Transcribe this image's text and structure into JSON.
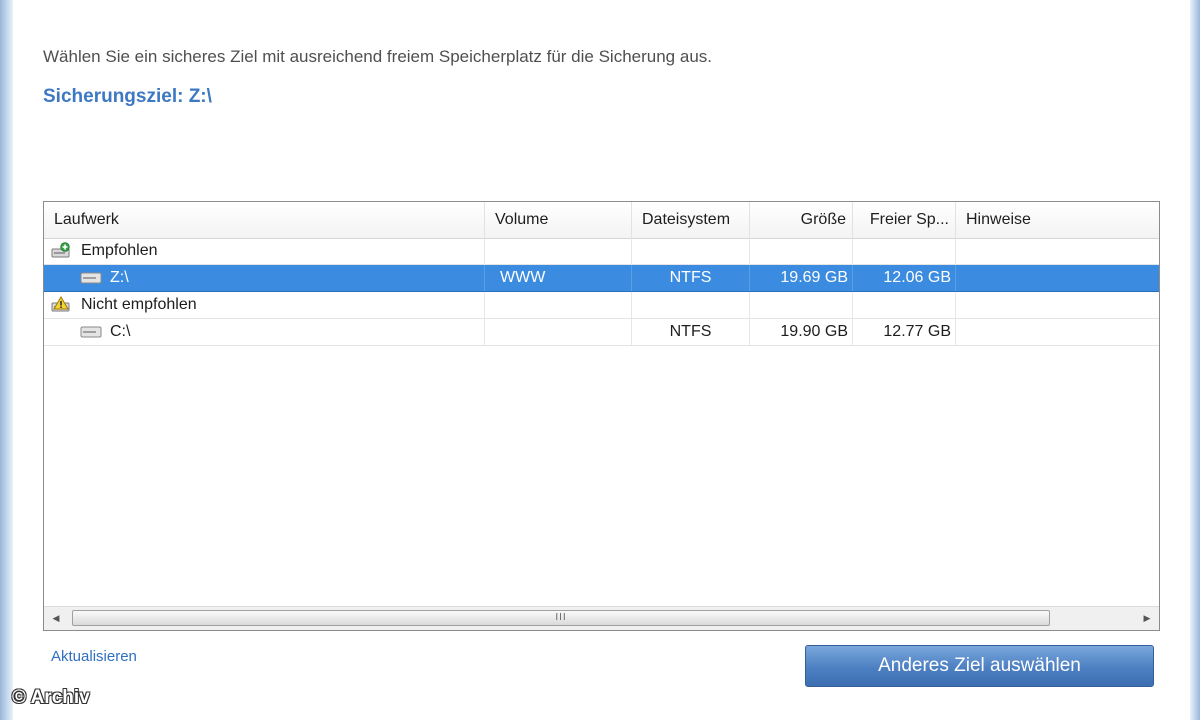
{
  "instruction": "Wählen Sie ein sicheres Ziel mit ausreichend freiem Speicherplatz für die Sicherung aus.",
  "target_label": "Sicherungsziel: Z:\\",
  "table": {
    "columns": [
      "Laufwerk",
      "Volume",
      "Dateisystem",
      "Größe",
      "Freier Sp...",
      "Hinweise"
    ],
    "groups": [
      {
        "name": "Empfohlen",
        "icon": "recommended-drive-icon",
        "drives": [
          {
            "drive": "Z:\\",
            "volume": "WWW",
            "filesystem": "NTFS",
            "size": "19.69 GB",
            "free": "12.06 GB",
            "notes": "",
            "selected": true
          }
        ]
      },
      {
        "name": "Nicht empfohlen",
        "icon": "warning-drive-icon",
        "drives": [
          {
            "drive": "C:\\",
            "volume": "",
            "filesystem": "NTFS",
            "size": "19.90 GB",
            "free": "12.77 GB",
            "notes": "",
            "selected": false
          }
        ]
      }
    ]
  },
  "scrollbar": {
    "left_arrow": "◀",
    "right_arrow": "▶",
    "grip": "III"
  },
  "refresh_link": "Aktualisieren",
  "choose_button": "Anderes Ziel auswählen",
  "watermark": "© Archiv",
  "colors": {
    "accent": "#3d78c4",
    "selection": "#3b8ce0",
    "button": "#4d80c2"
  }
}
